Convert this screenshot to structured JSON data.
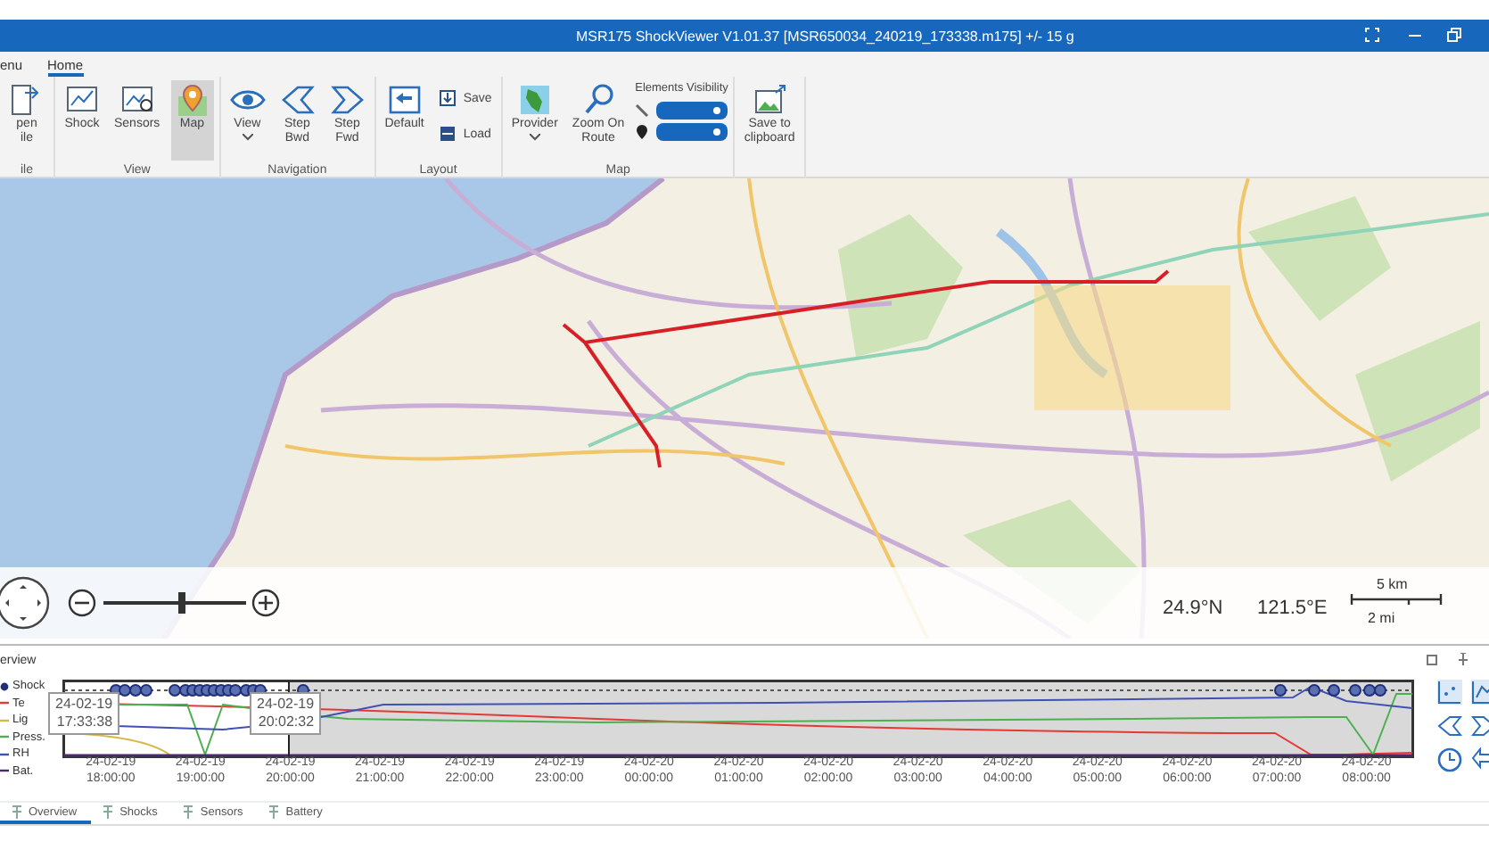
{
  "window": {
    "title": "MSR175 ShockViewer V1.01.37 [MSR650034_240219_173338.m175] +/- 15 g"
  },
  "ribbon": {
    "tabs": [
      {
        "label": "enu",
        "selected": false
      },
      {
        "label": "Home",
        "selected": true
      }
    ],
    "groups": [
      {
        "label": "ile",
        "items": [
          {
            "kind": "large",
            "label": "pen\nile",
            "selected": false,
            "has_menu": false
          }
        ]
      },
      {
        "label": "View",
        "items": [
          {
            "kind": "large",
            "label": "Shock",
            "selected": false,
            "has_menu": false
          },
          {
            "kind": "large",
            "label": "Sensors",
            "selected": false,
            "has_menu": false
          },
          {
            "kind": "large",
            "label": "Map",
            "selected": true,
            "has_menu": false
          }
        ]
      },
      {
        "label": "Navigation",
        "items": [
          {
            "kind": "large",
            "label": "View",
            "selected": false,
            "has_menu": true
          },
          {
            "kind": "large",
            "label": "Step\nBwd",
            "selected": false,
            "has_menu": false
          },
          {
            "kind": "large",
            "label": "Step\nFwd",
            "selected": false,
            "has_menu": false
          }
        ]
      },
      {
        "label": "Layout",
        "items": [
          {
            "kind": "large",
            "label": "Default",
            "selected": false,
            "has_menu": false
          },
          {
            "kind": "small",
            "label": "Save"
          },
          {
            "kind": "small",
            "label": "Load"
          }
        ]
      },
      {
        "label": "Map",
        "items": [
          {
            "kind": "large",
            "label": "Provider",
            "selected": false,
            "has_menu": true
          },
          {
            "kind": "large",
            "label": "Zoom On\nRoute",
            "selected": false,
            "has_menu": false
          },
          {
            "kind": "toggles",
            "label": "Elements Visibility",
            "toggles": [
              {
                "on": true
              },
              {
                "on": true
              }
            ]
          }
        ]
      },
      {
        "items": [
          {
            "kind": "large",
            "label": "Save to\nclipboard",
            "selected": false,
            "has_menu": false
          }
        ]
      }
    ]
  },
  "map": {
    "zoom": {
      "level": 0.55
    },
    "latitude": "24.9°N",
    "longitude": "121.5°E",
    "scale": {
      "top": "5 km",
      "bottom": "2 mi"
    }
  },
  "panel": {
    "title": "erview",
    "legend": [
      {
        "kind": "marker",
        "label": "Shock",
        "color": "#1f2f7a"
      },
      {
        "kind": "line",
        "label": "Te",
        "color": "#e53935"
      },
      {
        "kind": "line",
        "label": "Lig",
        "color": "#d4b84a"
      },
      {
        "kind": "line",
        "label": "Press.",
        "color": "#4caf50"
      },
      {
        "kind": "line",
        "label": "RH",
        "color": "#3f51b5"
      },
      {
        "kind": "line",
        "label": "Bat.",
        "color": "#4a2a6a"
      }
    ],
    "tooltips": [
      {
        "date": "24-02-19",
        "time": "17:33:38"
      },
      {
        "date": "24-02-19",
        "time": "20:02:32"
      }
    ],
    "x_labels": [
      {
        "date": "24-02-19",
        "time": "18:00:00"
      },
      {
        "date": "24-02-19",
        "time": "19:00:00"
      },
      {
        "date": "24-02-19",
        "time": "20:00:00"
      },
      {
        "date": "24-02-19",
        "time": "21:00:00"
      },
      {
        "date": "24-02-19",
        "time": "22:00:00"
      },
      {
        "date": "24-02-19",
        "time": "23:00:00"
      },
      {
        "date": "24-02-20",
        "time": "00:00:00"
      },
      {
        "date": "24-02-20",
        "time": "01:00:00"
      },
      {
        "date": "24-02-20",
        "time": "02:00:00"
      },
      {
        "date": "24-02-20",
        "time": "03:00:00"
      },
      {
        "date": "24-02-20",
        "time": "04:00:00"
      },
      {
        "date": "24-02-20",
        "time": "05:00:00"
      },
      {
        "date": "24-02-20",
        "time": "06:00:00"
      },
      {
        "date": "24-02-20",
        "time": "07:00:00"
      },
      {
        "date": "24-02-20",
        "time": "08:00:00"
      }
    ],
    "tabs": [
      {
        "label": "Overview",
        "selected": true
      },
      {
        "label": "Shocks",
        "selected": false
      },
      {
        "label": "Sensors",
        "selected": false
      },
      {
        "label": "Battery",
        "selected": false
      }
    ]
  }
}
